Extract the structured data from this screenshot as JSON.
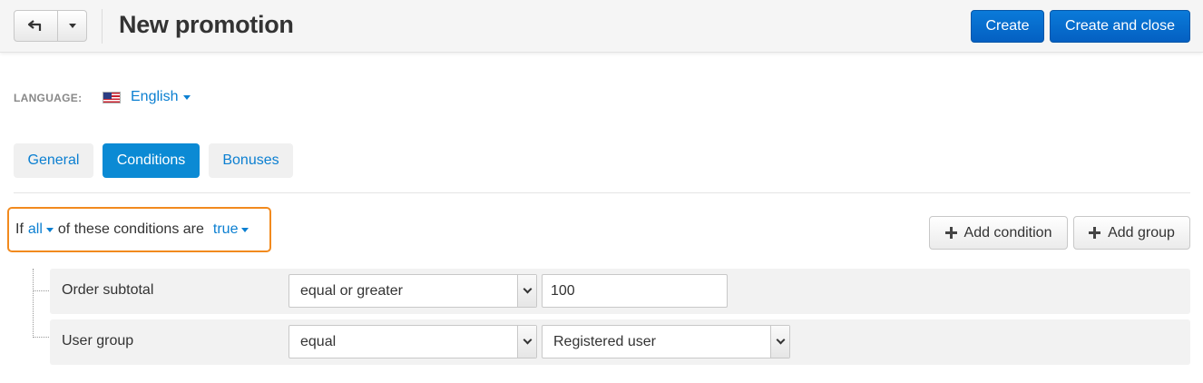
{
  "header": {
    "title": "New promotion",
    "create_label": "Create",
    "create_close_label": "Create and close"
  },
  "language": {
    "label": "LANGUAGE:",
    "value": "English"
  },
  "tabs": [
    {
      "label": "General",
      "active": false
    },
    {
      "label": "Conditions",
      "active": true
    },
    {
      "label": "Bonuses",
      "active": false
    }
  ],
  "conditions": {
    "prefix": "If",
    "quantifier": "all",
    "middle": "of these conditions are",
    "truth": "true",
    "add_condition_label": "Add condition",
    "add_group_label": "Add group",
    "rows": [
      {
        "label": "Order subtotal",
        "operator": "equal or greater",
        "value": "100"
      },
      {
        "label": "User group",
        "operator": "equal",
        "value": "Registered user"
      }
    ]
  },
  "colors": {
    "accent": "#0b7fd1",
    "primary_button": "#0460c2",
    "active_tab": "#0b8ad4",
    "highlight_border": "#f28a1e"
  }
}
